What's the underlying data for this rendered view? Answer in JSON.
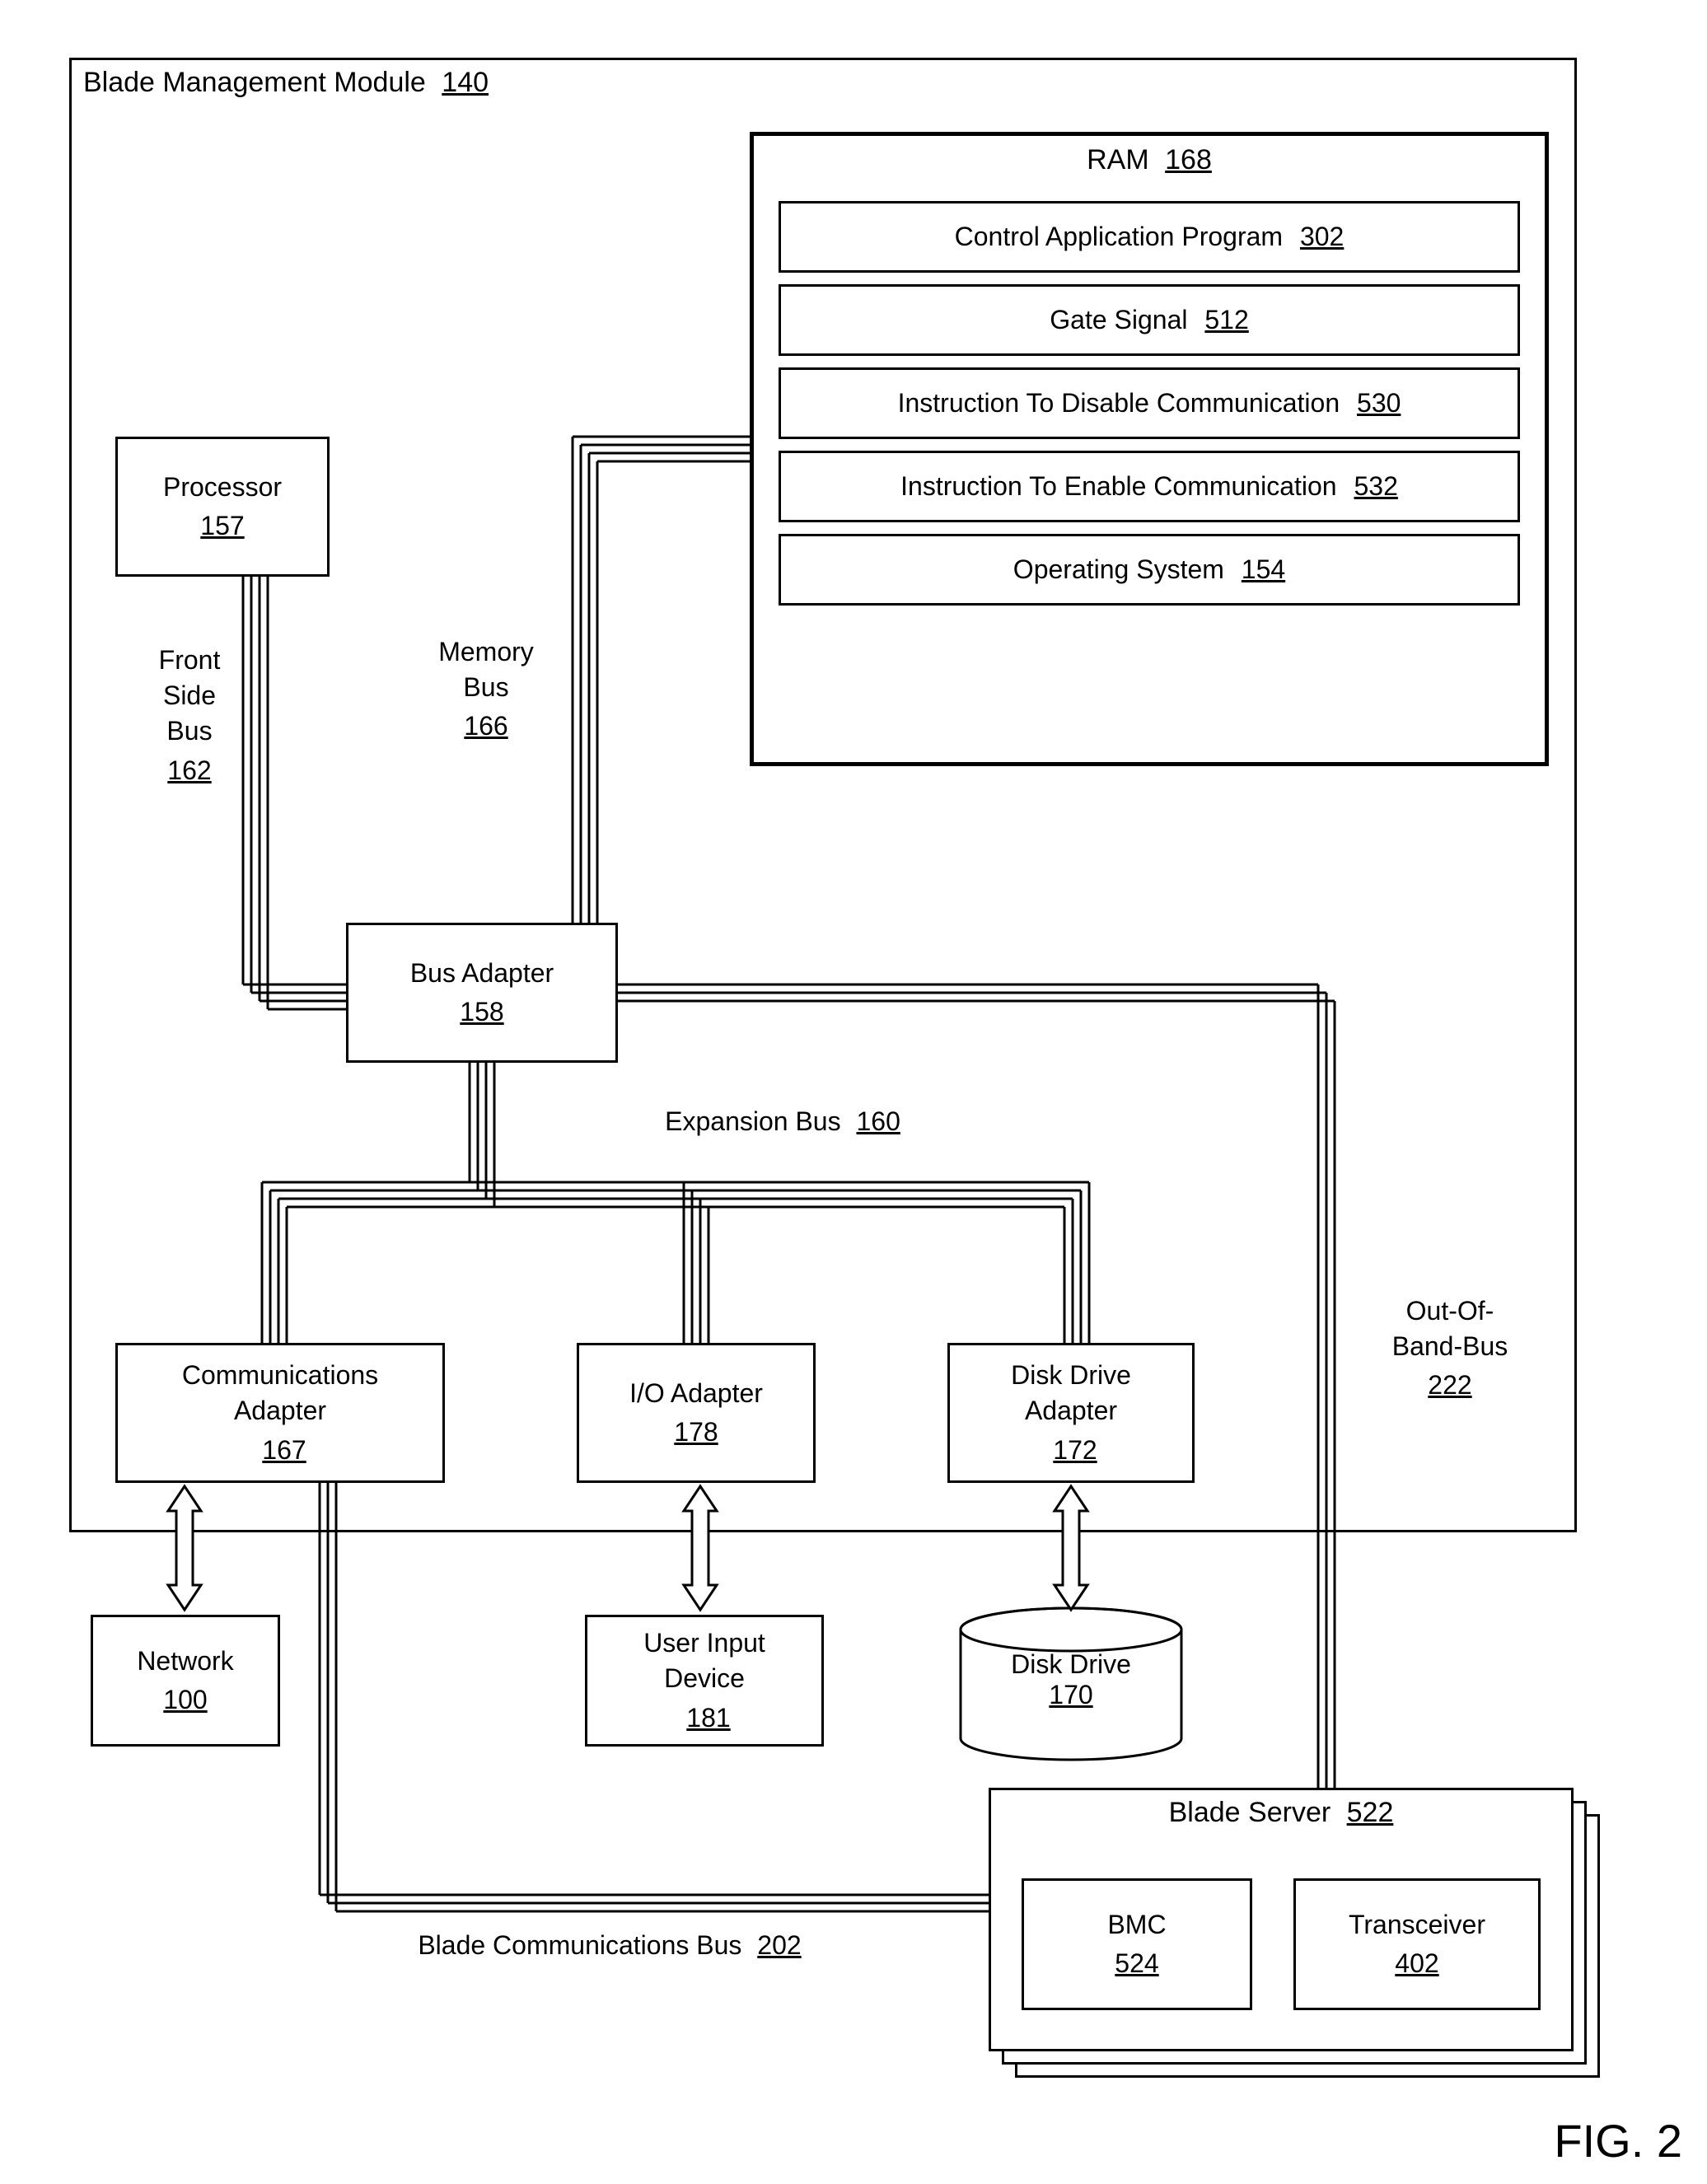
{
  "outer": {
    "title": "Blade Management Module",
    "ref": "140"
  },
  "ram": {
    "title": "RAM",
    "ref": "168",
    "items": [
      {
        "label": "Control Application Program",
        "ref": "302"
      },
      {
        "label": "Gate Signal",
        "ref": "512"
      },
      {
        "label": "Instruction To Disable Communication",
        "ref": "530"
      },
      {
        "label": "Instruction To Enable Communication",
        "ref": "532"
      },
      {
        "label": "Operating System",
        "ref": "154"
      }
    ]
  },
  "processor": {
    "label": "Processor",
    "ref": "157"
  },
  "fsb": {
    "label": "Front\nSide\nBus",
    "ref": "162"
  },
  "membus": {
    "label": "Memory\nBus",
    "ref": "166"
  },
  "busadapter": {
    "label": "Bus Adapter",
    "ref": "158"
  },
  "expbus": {
    "label": "Expansion Bus",
    "ref": "160"
  },
  "oobbus": {
    "label": "Out-Of-\nBand-Bus",
    "ref": "222"
  },
  "commadapter": {
    "label": "Communications\nAdapter",
    "ref": "167"
  },
  "ioadapter": {
    "label": "I/O Adapter",
    "ref": "178"
  },
  "ddadapter": {
    "label": "Disk Drive\nAdapter",
    "ref": "172"
  },
  "network": {
    "label": "Network",
    "ref": "100"
  },
  "uid": {
    "label": "User Input\nDevice",
    "ref": "181"
  },
  "diskdrive": {
    "label": "Disk Drive",
    "ref": "170"
  },
  "bladeserver": {
    "label": "Blade Server",
    "ref": "522"
  },
  "bmc": {
    "label": "BMC",
    "ref": "524"
  },
  "xcvr": {
    "label": "Transceiver",
    "ref": "402"
  },
  "bladebus": {
    "label": "Blade Communications Bus",
    "ref": "202"
  },
  "fig": "FIG. 2"
}
